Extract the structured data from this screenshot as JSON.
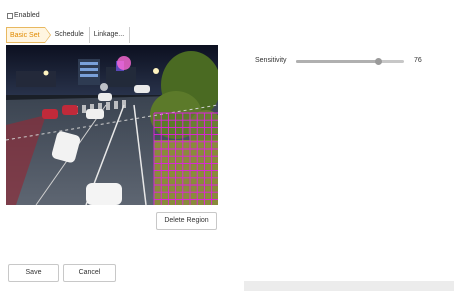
{
  "enable": {
    "label": "Enabled",
    "checked": false
  },
  "tabs": [
    {
      "label": "Basic Set"
    },
    {
      "label": "Schedule"
    },
    {
      "label": "Linkage..."
    }
  ],
  "video": {
    "description_icon": "camera-feed"
  },
  "region": {
    "color": "#e020e0"
  },
  "sensitivity": {
    "label": "Sensitivity",
    "value": "76",
    "level": 0.76
  },
  "buttons": {
    "delete_region": "Delete Region",
    "save": "Save",
    "cancel": "Cancel"
  },
  "colors": {
    "accent": "#e08a00",
    "accent_bg": "#fff5e0",
    "grid": "#e020e0"
  }
}
